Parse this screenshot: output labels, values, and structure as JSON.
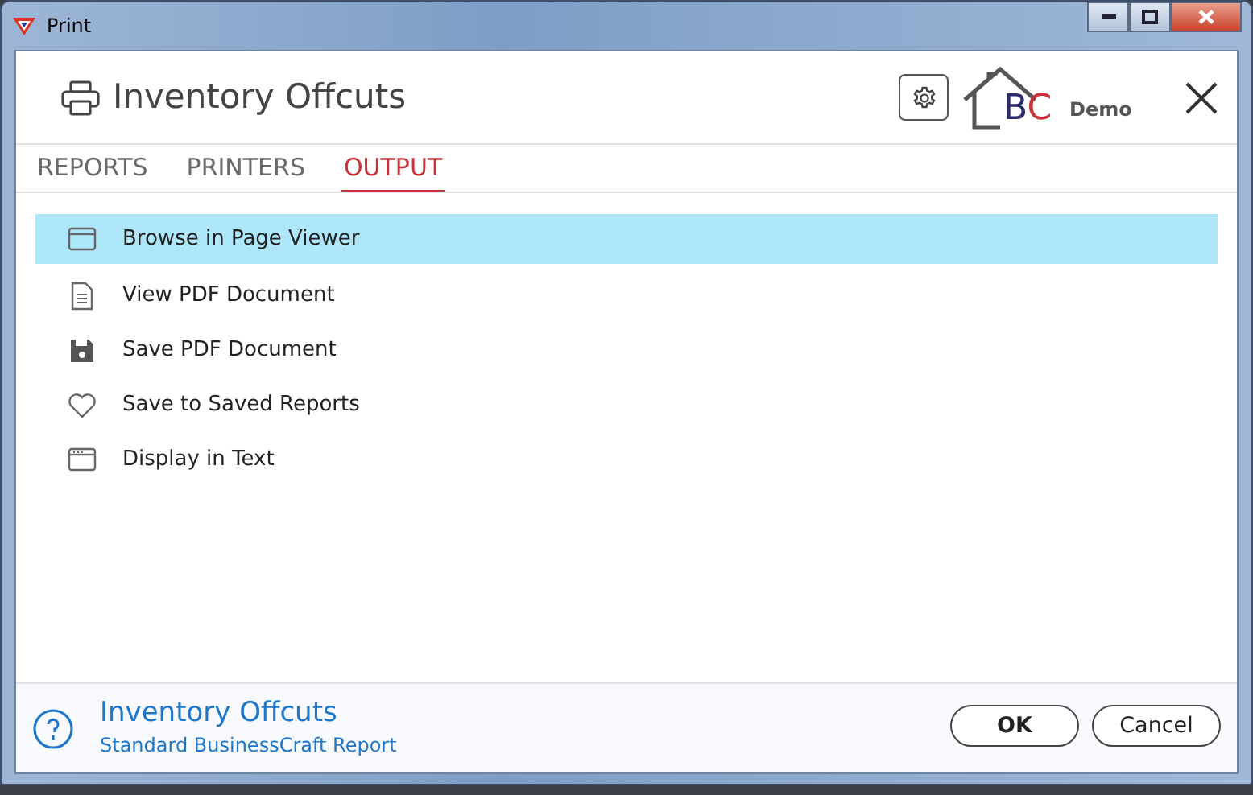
{
  "window": {
    "title": "Print"
  },
  "header": {
    "title": "Inventory Offcuts",
    "logo_letters": [
      "B",
      "C"
    ],
    "logo_label": "Demo"
  },
  "tabs": [
    {
      "label": "REPORTS",
      "selected": false
    },
    {
      "label": "PRINTERS",
      "selected": false
    },
    {
      "label": "OUTPUT",
      "selected": true
    }
  ],
  "outputs": [
    {
      "kind": "viewer",
      "label": "Browse in Page Viewer",
      "selected": true
    },
    {
      "kind": "document",
      "label": "View PDF Document",
      "selected": false
    },
    {
      "kind": "save",
      "label": "Save PDF Document",
      "selected": false
    },
    {
      "kind": "heart",
      "label": "Save to Saved Reports",
      "selected": false
    },
    {
      "kind": "text",
      "label": "Display in Text",
      "selected": false
    }
  ],
  "footer": {
    "title": "Inventory Offcuts",
    "subtitle": "Standard BusinessCraft Report",
    "buttons": [
      "OK",
      "Cancel"
    ]
  }
}
